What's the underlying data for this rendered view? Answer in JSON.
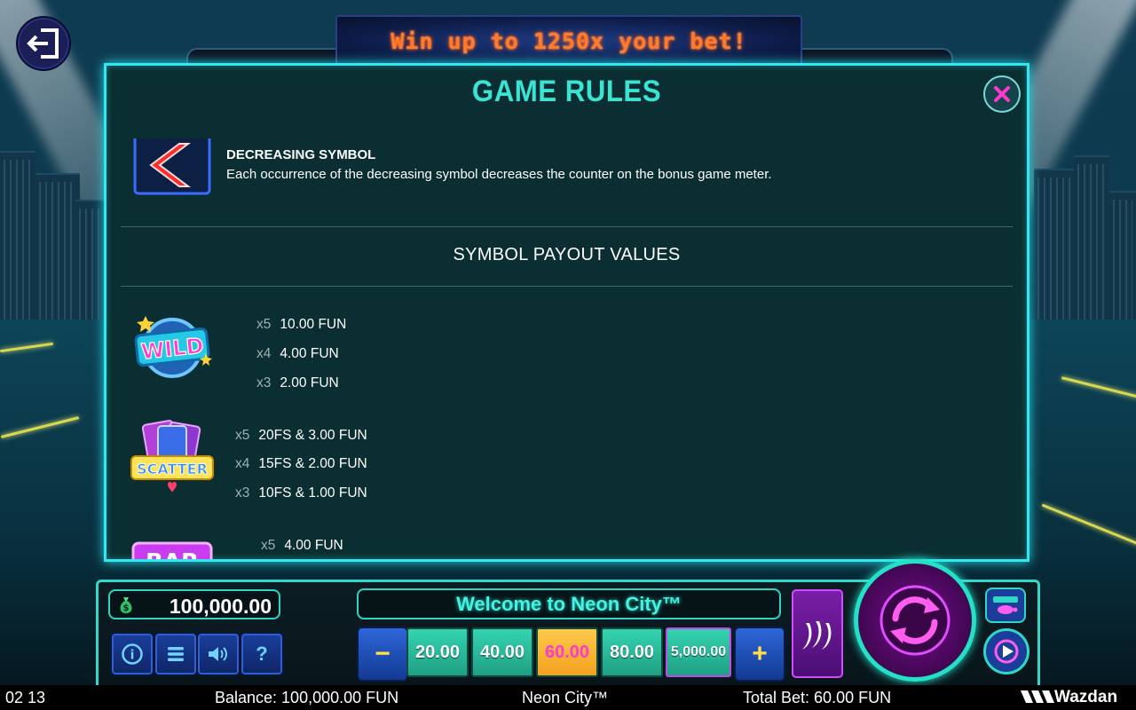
{
  "banner": {
    "text": "Win up to 1250x your bet!"
  },
  "modal": {
    "title": "GAME RULES",
    "decreasing": {
      "heading": "DECREASING SYMBOL",
      "text": "Each occurrence of the decreasing symbol decreases the counter on the bonus game meter."
    },
    "payout_title": "SYMBOL PAYOUT VALUES",
    "symbols": [
      {
        "icon": "wild-symbol",
        "label": "WILD",
        "rows": [
          {
            "mult": "x5",
            "value": "10.00 FUN"
          },
          {
            "mult": "x4",
            "value": "4.00 FUN"
          },
          {
            "mult": "x3",
            "value": "2.00 FUN"
          }
        ]
      },
      {
        "icon": "scatter-symbol",
        "label": "SCATTER",
        "rows": [
          {
            "mult": "x5",
            "value": "20FS & 3.00 FUN"
          },
          {
            "mult": "x4",
            "value": "15FS & 2.00 FUN"
          },
          {
            "mult": "x3",
            "value": "10FS & 1.00 FUN"
          }
        ]
      },
      {
        "icon": "bar-symbol",
        "label": "BAR",
        "rows": [
          {
            "mult": "x5",
            "value": "4.00 FUN"
          }
        ]
      }
    ]
  },
  "controls": {
    "balance": "100,000.00",
    "message": "Welcome to Neon City™",
    "bets": [
      "20.00",
      "40.00",
      "60.00",
      "80.00",
      "5,000.00"
    ],
    "selected_bet_index": 2,
    "info_icon": "i",
    "help_icon": "?",
    "minus": "−",
    "plus": "+"
  },
  "status_bar": {
    "time": "02 13",
    "balance": "Balance: 100,000.00 FUN",
    "game": "Neon City™",
    "total_bet": "Total Bet: 60.00 FUN",
    "brand": "Wazdan"
  },
  "colors": {
    "accent": "#32e8f0",
    "title": "#3be3d3",
    "modal_bg": "#0a2e31",
    "bet_green": "#2bbf9c",
    "bet_selected": "#f7b731",
    "selected_text": "#ff38d0"
  }
}
